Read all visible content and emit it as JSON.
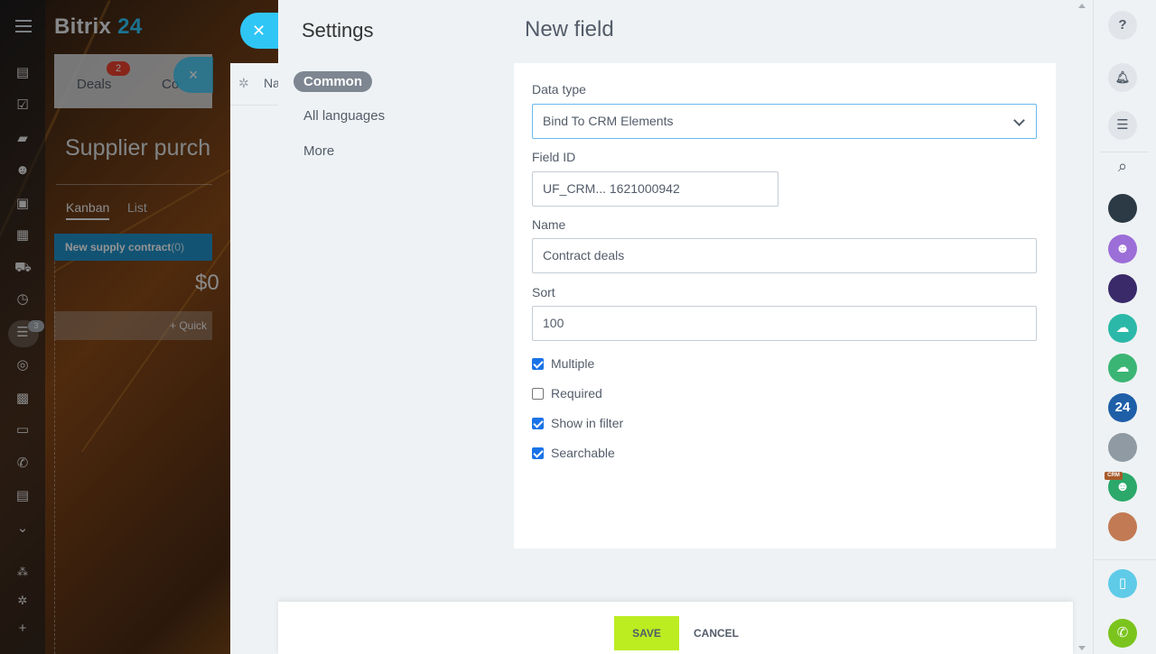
{
  "app": {
    "logo_word": "Bitrix",
    "logo_num": "24",
    "tabs": {
      "deals": "Deals",
      "deals_badge": "2",
      "contacts_partial": "Co"
    },
    "page_title": "Supplier purcha",
    "views": {
      "kanban": "Kanban",
      "list": "List"
    },
    "stage": {
      "name": "New supply contract",
      "count": "(0)",
      "sum_partial": "$0"
    },
    "quick_add": "+ Quick",
    "filter_badge": "3",
    "mid_slider_label": "Na"
  },
  "settings": {
    "title": "Settings",
    "nav": {
      "common": "Common",
      "all_languages": "All languages",
      "more": "More"
    }
  },
  "form": {
    "title": "New field",
    "data_type": {
      "label": "Data type",
      "value": "Bind To CRM Elements"
    },
    "field_id": {
      "label": "Field ID",
      "value": "UF_CRM... 1621000942"
    },
    "name": {
      "label": "Name",
      "value": "Contract deals"
    },
    "sort": {
      "label": "Sort",
      "value": "100"
    },
    "checkboxes": {
      "multiple": {
        "label": "Multiple",
        "checked": true
      },
      "required": {
        "label": "Required",
        "checked": false
      },
      "show_in_filter": {
        "label": "Show in filter",
        "checked": true
      },
      "searchable": {
        "label": "Searchable",
        "checked": true
      }
    }
  },
  "footer": {
    "save": "SAVE",
    "cancel": "CANCEL"
  },
  "rightbar": {
    "help_glyph": "?",
    "badge_24": "24",
    "crm_tag": "CRM"
  },
  "colors": {
    "accent": "#2fc6f6",
    "save": "#bbed21",
    "stage": "#1f8fc8",
    "checkbox": "#1a73e8"
  }
}
